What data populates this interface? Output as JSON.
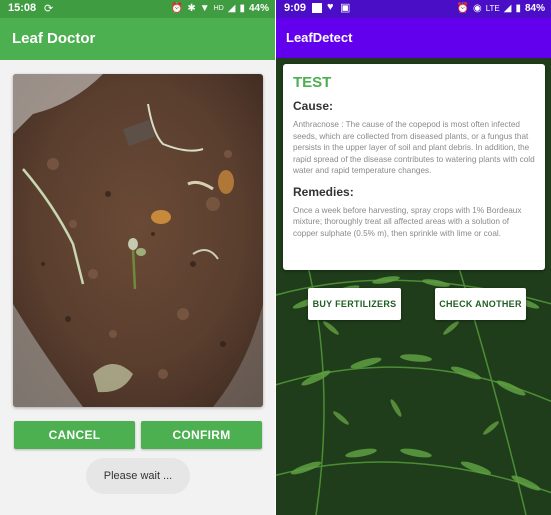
{
  "left": {
    "status": {
      "time": "15:08",
      "battery": "44%"
    },
    "appbar": {
      "title": "Leaf Doctor"
    },
    "buttons": {
      "cancel": "CANCEL",
      "confirm": "CONFIRM"
    },
    "toast": "Please wait ..."
  },
  "right": {
    "status": {
      "time": "9:09",
      "network": "LTE",
      "battery": "84%"
    },
    "appbar": {
      "title": "LeafDetect"
    },
    "card": {
      "title": "TEST",
      "cause_heading": "Cause:",
      "cause_text": "Anthracnose : The cause of the copepod is most often infected seeds, which are collected from diseased plants, or a fungus that persists in the upper layer of soil and plant debris. In addition, the rapid spread of the disease contributes to watering plants with cold water and rapid temperature changes.",
      "remedies_heading": "Remedies:",
      "remedies_text": "Once a week before harvesting, spray crops with 1% Bordeaux mixture; thoroughly treat all affected areas with a solution of copper sulphate (0.5% m), then sprinkle with lime or coal."
    },
    "buttons": {
      "buy": "BUY FERTILIZERS",
      "check": "CHECK ANOTHER"
    }
  },
  "colors": {
    "leaf_doctor_green": "#4caf50",
    "leafdetect_purple": "#6200ee",
    "card_title_green": "#4caf50"
  }
}
